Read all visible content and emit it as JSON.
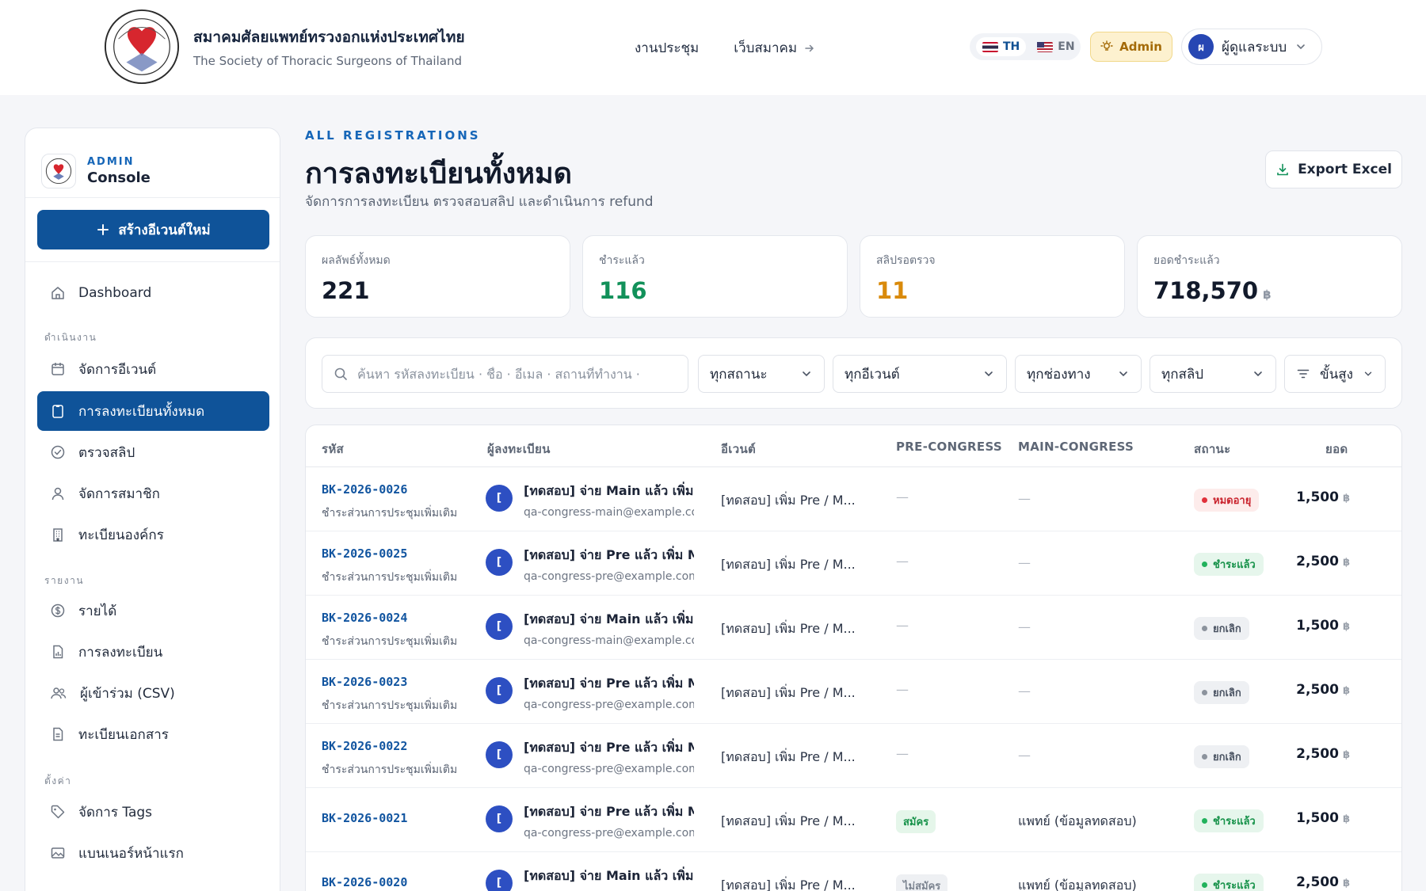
{
  "header": {
    "org_name_th": "สมาคมศัลยแพทย์ทรวงอกแห่งประเทศไทย",
    "org_name_en": "The Society of Thoracic Surgeons of Thailand",
    "nav": [
      {
        "label": "งานประชุม"
      },
      {
        "label": "เว็บสมาคม",
        "icon": "arrow-right-icon"
      }
    ],
    "lang": {
      "th": "TH",
      "en": "EN",
      "active": "TH"
    },
    "admin_label": "Admin",
    "user": {
      "initial": "ผ",
      "name": "ผู้ดูแลระบบ"
    }
  },
  "sidebar": {
    "console_small": "ADMIN",
    "console_big": "Console",
    "create_button": "สร้างอีเวนต์ใหม่",
    "sections": {
      "ops": "ดำเนินงาน",
      "reports": "รายงาน",
      "settings": "ตั้งค่า"
    },
    "items": {
      "dashboard": "Dashboard",
      "events": "จัดการอีเวนต์",
      "registrations": "การลงทะเบียนทั้งหมด",
      "slips": "ตรวจสลิป",
      "members": "จัดการสมาชิก",
      "orgs": "ทะเบียนองค์กร",
      "revenue": "รายได้",
      "reg_report": "การลงทะเบียน",
      "attendees": "ผู้เข้าร่วม (CSV)",
      "documents": "ทะเบียนเอกสาร",
      "tags": "จัดการ Tags",
      "banner": "แบนเนอร์หน้าแรก"
    },
    "active": "registrations"
  },
  "page": {
    "eyebrow": "ALL REGISTRATIONS",
    "title": "การลงทะเบียนทั้งหมด",
    "subtitle": "จัดการการลงทะเบียน ตรวจสอบสลิป และดำเนินการ refund",
    "export_label": "Export Excel"
  },
  "stats": [
    {
      "label": "ผลลัพธ์ทั้งหมด",
      "value": "221",
      "color": "#121a2b",
      "unit": ""
    },
    {
      "label": "ชำระแล้ว",
      "value": "116",
      "color": "#12915a",
      "unit": ""
    },
    {
      "label": "สลิปรอตรวจ",
      "value": "11",
      "color": "#d98a0b",
      "unit": ""
    },
    {
      "label": "ยอดชำระแล้ว",
      "value": "718,570",
      "color": "#121a2b",
      "unit": "฿"
    }
  ],
  "filters": {
    "search_placeholder": "ค้นหา รหัสลงทะเบียน · ชื่อ · อีเมล · สถานที่ทำงาน ·",
    "search_value": "",
    "status": "ทุกสถานะ",
    "event": "ทุกอีเวนต์",
    "channel": "ทุกช่องทาง",
    "slip": "ทุกสลิป",
    "advanced": "ขั้นสูง"
  },
  "table": {
    "columns": {
      "code": "รหัส",
      "registrant": "ผู้ลงทะเบียน",
      "event": "อีเวนต์",
      "pre": "PRE-CONGRESS",
      "main": "MAIN-CONGRESS",
      "status": "สถานะ",
      "amount": "ยอด"
    },
    "currency": "฿",
    "rows": [
      {
        "code": "BK-2026-0026",
        "sub": "ชำระส่วนการประชุมเพิ่มเติม",
        "initial": "[",
        "name": "[ทดสอบ] จ่าย Main แล้ว เพิ่ม Pre",
        "email": "qa-congress-main@example.com",
        "event": "[ทดสอบ] เพิ่ม Pre / M...",
        "pre": "—",
        "main": "—",
        "status": "หมดอายุ",
        "status_type": "expired",
        "amount": "1,500"
      },
      {
        "code": "BK-2026-0025",
        "sub": "ชำระส่วนการประชุมเพิ่มเติม",
        "initial": "[",
        "name": "[ทดสอบ] จ่าย Pre แล้ว เพิ่ม Main",
        "email": "qa-congress-pre@example.com",
        "event": "[ทดสอบ] เพิ่ม Pre / M...",
        "pre": "—",
        "main": "—",
        "status": "ชำระแล้ว",
        "status_type": "paid",
        "amount": "2,500"
      },
      {
        "code": "BK-2026-0024",
        "sub": "ชำระส่วนการประชุมเพิ่มเติม",
        "initial": "[",
        "name": "[ทดสอบ] จ่าย Main แล้ว เพิ่ม Pre",
        "email": "qa-congress-main@example.com",
        "event": "[ทดสอบ] เพิ่ม Pre / M...",
        "pre": "—",
        "main": "—",
        "status": "ยกเลิก",
        "status_type": "cancel",
        "amount": "1,500"
      },
      {
        "code": "BK-2026-0023",
        "sub": "ชำระส่วนการประชุมเพิ่มเติม",
        "initial": "[",
        "name": "[ทดสอบ] จ่าย Pre แล้ว เพิ่ม Main",
        "email": "qa-congress-pre@example.com",
        "event": "[ทดสอบ] เพิ่ม Pre / M...",
        "pre": "—",
        "main": "—",
        "status": "ยกเลิก",
        "status_type": "cancel",
        "amount": "2,500"
      },
      {
        "code": "BK-2026-0022",
        "sub": "ชำระส่วนการประชุมเพิ่มเติม",
        "initial": "[",
        "name": "[ทดสอบ] จ่าย Pre แล้ว เพิ่ม Main",
        "email": "qa-congress-pre@example.com",
        "event": "[ทดสอบ] เพิ่ม Pre / M...",
        "pre": "—",
        "main": "—",
        "status": "ยกเลิก",
        "status_type": "cancel",
        "amount": "2,500"
      },
      {
        "code": "BK-2026-0021",
        "sub": "",
        "initial": "[",
        "name": "[ทดสอบ] จ่าย Pre แล้ว เพิ่ม Main",
        "email": "qa-congress-pre@example.com",
        "event": "[ทดสอบ] เพิ่ม Pre / M...",
        "pre": "สมัคร",
        "pre_type": "apply",
        "main": "แพทย์ (ข้อมูลทดสอบ)",
        "status": "ชำระแล้ว",
        "status_type": "paid",
        "amount": "1,500"
      },
      {
        "code": "BK-2026-0020",
        "sub": "",
        "initial": "[",
        "name": "[ทดสอบ] จ่าย Main แล้ว เพิ่ม Pre",
        "email": "qa-congress-main@example.com",
        "event": "[ทดสอบ] เพิ่ม Pre / M...",
        "pre": "ไม่สมัคร",
        "pre_type": "no",
        "main": "แพทย์ (ข้อมูลทดสอบ)",
        "status": "ชำระแล้ว",
        "status_type": "paid",
        "amount": "2,500"
      }
    ]
  }
}
